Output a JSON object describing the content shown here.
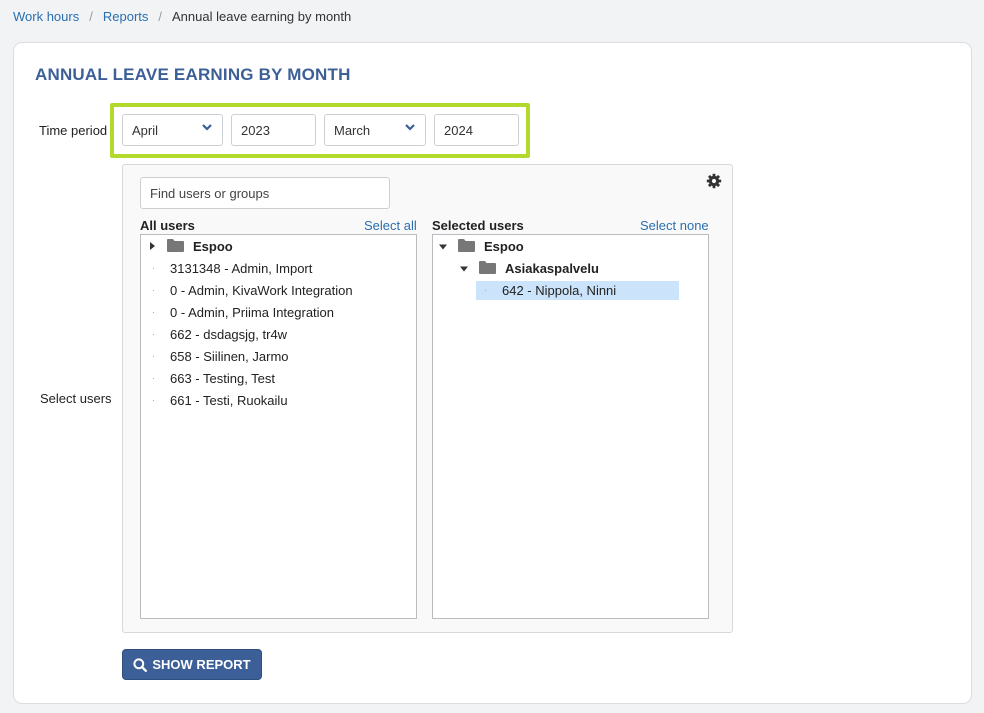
{
  "breadcrumb": {
    "items": [
      "Work hours",
      "Reports"
    ],
    "current": "Annual leave earning by month",
    "separator": "/"
  },
  "page": {
    "title": "ANNUAL LEAVE EARNING BY MONTH"
  },
  "time_period": {
    "label": "Time period",
    "start_month": "April",
    "start_year": "2023",
    "end_month": "March",
    "end_year": "2024",
    "highlight_color": "#b3d92c"
  },
  "select_users": {
    "label": "Select users",
    "search_placeholder": "Find users or groups",
    "gear_icon": "gear-icon",
    "all_users": {
      "title": "All users",
      "action": "Select all",
      "group": "Espoo",
      "items": [
        "3131348 - Admin, Import",
        "0 - Admin, KivaWork Integration",
        "0 - Admin, Priima Integration",
        "662 - dsdagsjg, tr4w",
        "658 - Siilinen, Jarmo",
        "663 - Testing, Test",
        "661 - Testi, Ruokailu"
      ]
    },
    "selected_users": {
      "title": "Selected users",
      "action": "Select none",
      "group": "Espoo",
      "subgroup": "Asiakaspalvelu",
      "items": [
        "642 - Nippola, Ninni"
      ]
    }
  },
  "actions": {
    "show_report": "SHOW REPORT",
    "show_report_icon": "search-icon"
  },
  "colors": {
    "accent": "#3c5f98",
    "link": "#2a6fb0",
    "selection": "#cce4fb"
  }
}
